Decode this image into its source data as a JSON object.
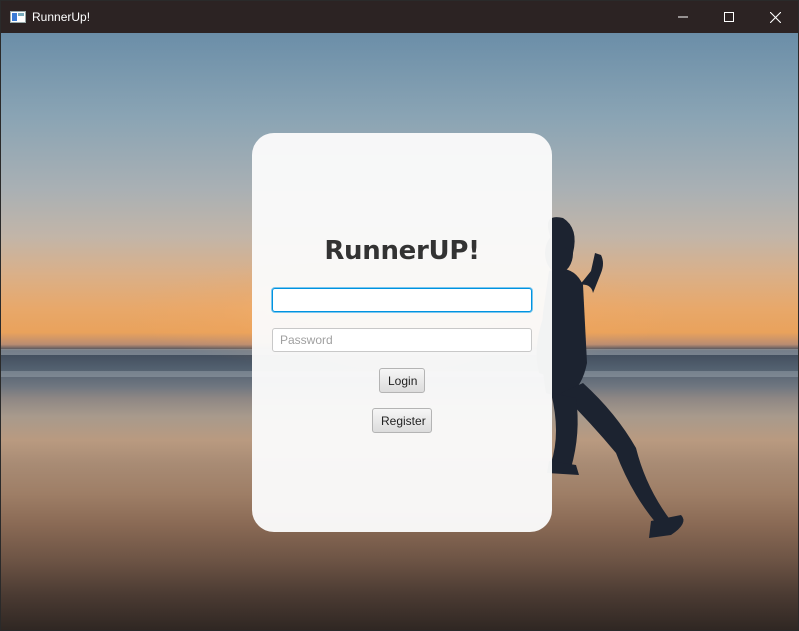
{
  "window": {
    "title": "RunnerUp!",
    "controls": {
      "minimize_icon": "minimize-icon",
      "maximize_icon": "maximize-icon",
      "close_icon": "close-icon"
    }
  },
  "login_card": {
    "title": "RunnerUP!",
    "username": {
      "value": "",
      "placeholder": ""
    },
    "password": {
      "value": "",
      "placeholder": "Password"
    },
    "login_label": "Login",
    "register_label": "Register"
  },
  "colors": {
    "titlebar": "#2c2323",
    "card": "#fafafa",
    "focus_border": "#0093e0"
  }
}
